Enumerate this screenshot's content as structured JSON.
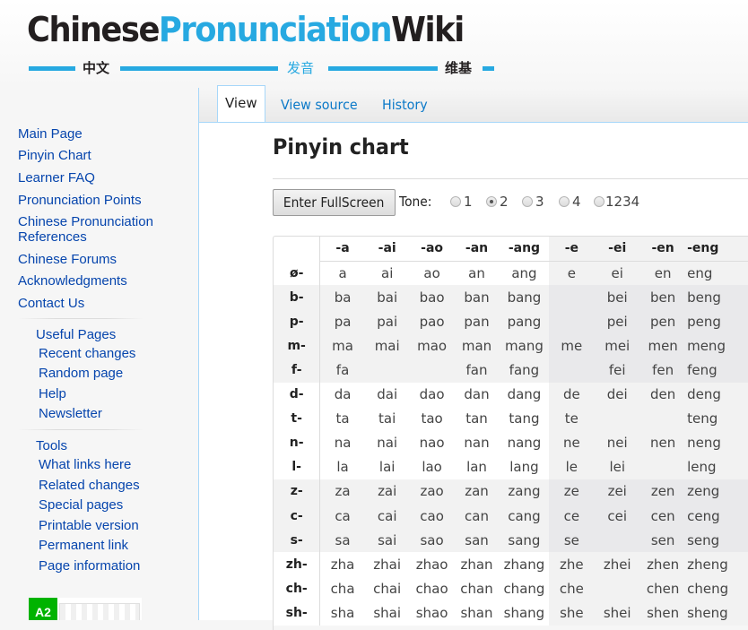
{
  "logo": {
    "part1": "Chinese",
    "part2": "Pronunciation",
    "part3": "Wiki",
    "cn1": "中文",
    "cn2": "发音",
    "cn3": "维基",
    "colors": {
      "dark": "#231f20",
      "blue": "#27a9e1"
    }
  },
  "sidebar": {
    "main_links": [
      "Main Page",
      "Pinyin Chart",
      "Learner FAQ",
      "Pronunciation Points",
      "Chinese Pronunciation References",
      "Chinese Forums",
      "Acknowledgments",
      "Contact Us"
    ],
    "useful_pages": {
      "heading": "Useful Pages",
      "links": [
        "Recent changes",
        "Random page",
        "Help",
        "Newsletter"
      ]
    },
    "tools": {
      "heading": "Tools",
      "links": [
        "What links here",
        "Related changes",
        "Special pages",
        "Printable version",
        "Permanent link",
        "Page information"
      ]
    },
    "badge_label": "A2"
  },
  "tabs": [
    {
      "label": "View",
      "selected": true
    },
    {
      "label": "View source",
      "selected": false
    },
    {
      "label": "History",
      "selected": false
    }
  ],
  "page": {
    "title": "Pinyin chart",
    "fullscreen_button": "Enter FullScreen",
    "tone_label": "Tone:",
    "tone_options": [
      {
        "label": "1",
        "checked": false
      },
      {
        "label": "2",
        "checked": true
      },
      {
        "label": "3",
        "checked": false
      },
      {
        "label": "4",
        "checked": false
      },
      {
        "label": "1234",
        "checked": false
      }
    ]
  },
  "chart": {
    "finals": [
      "-a",
      "-ai",
      "-ao",
      "-an",
      "-ang",
      "-e",
      "-ei",
      "-en",
      "-eng"
    ],
    "rows": [
      {
        "initial": "ø-",
        "group": "white",
        "cells": [
          "a",
          "ai",
          "ao",
          "an",
          "ang",
          "e",
          "ei",
          "en",
          "eng"
        ]
      },
      {
        "initial": "b-",
        "group": "grey",
        "cells": [
          "ba",
          "bai",
          "bao",
          "ban",
          "bang",
          "",
          "bei",
          "ben",
          "beng"
        ]
      },
      {
        "initial": "p-",
        "group": "grey",
        "cells": [
          "pa",
          "pai",
          "pao",
          "pan",
          "pang",
          "",
          "pei",
          "pen",
          "peng"
        ]
      },
      {
        "initial": "m-",
        "group": "grey",
        "cells": [
          "ma",
          "mai",
          "mao",
          "man",
          "mang",
          "me",
          "mei",
          "men",
          "meng"
        ]
      },
      {
        "initial": "f-",
        "group": "grey",
        "cells": [
          "fa",
          "",
          "",
          "fan",
          "fang",
          "",
          "fei",
          "fen",
          "feng"
        ]
      },
      {
        "initial": "d-",
        "group": "white",
        "cells": [
          "da",
          "dai",
          "dao",
          "dan",
          "dang",
          "de",
          "dei",
          "den",
          "deng"
        ]
      },
      {
        "initial": "t-",
        "group": "white",
        "cells": [
          "ta",
          "tai",
          "tao",
          "tan",
          "tang",
          "te",
          "",
          "",
          "teng"
        ]
      },
      {
        "initial": "n-",
        "group": "white",
        "cells": [
          "na",
          "nai",
          "nao",
          "nan",
          "nang",
          "ne",
          "nei",
          "nen",
          "neng"
        ]
      },
      {
        "initial": "l-",
        "group": "white",
        "cells": [
          "la",
          "lai",
          "lao",
          "lan",
          "lang",
          "le",
          "lei",
          "",
          "leng"
        ]
      },
      {
        "initial": "z-",
        "group": "grey",
        "cells": [
          "za",
          "zai",
          "zao",
          "zan",
          "zang",
          "ze",
          "zei",
          "zen",
          "zeng"
        ]
      },
      {
        "initial": "c-",
        "group": "grey",
        "cells": [
          "ca",
          "cai",
          "cao",
          "can",
          "cang",
          "ce",
          "cei",
          "cen",
          "ceng"
        ]
      },
      {
        "initial": "s-",
        "group": "grey",
        "cells": [
          "sa",
          "sai",
          "sao",
          "san",
          "sang",
          "se",
          "",
          "sen",
          "seng"
        ]
      },
      {
        "initial": "zh-",
        "group": "white",
        "cells": [
          "zha",
          "zhai",
          "zhao",
          "zhan",
          "zhang",
          "zhe",
          "zhei",
          "zhen",
          "zheng"
        ]
      },
      {
        "initial": "ch-",
        "group": "white",
        "cells": [
          "cha",
          "chai",
          "chao",
          "chan",
          "chang",
          "che",
          "",
          "chen",
          "cheng"
        ]
      },
      {
        "initial": "sh-",
        "group": "white",
        "cells": [
          "sha",
          "shai",
          "shao",
          "shan",
          "shang",
          "she",
          "shei",
          "shen",
          "sheng"
        ]
      }
    ]
  }
}
